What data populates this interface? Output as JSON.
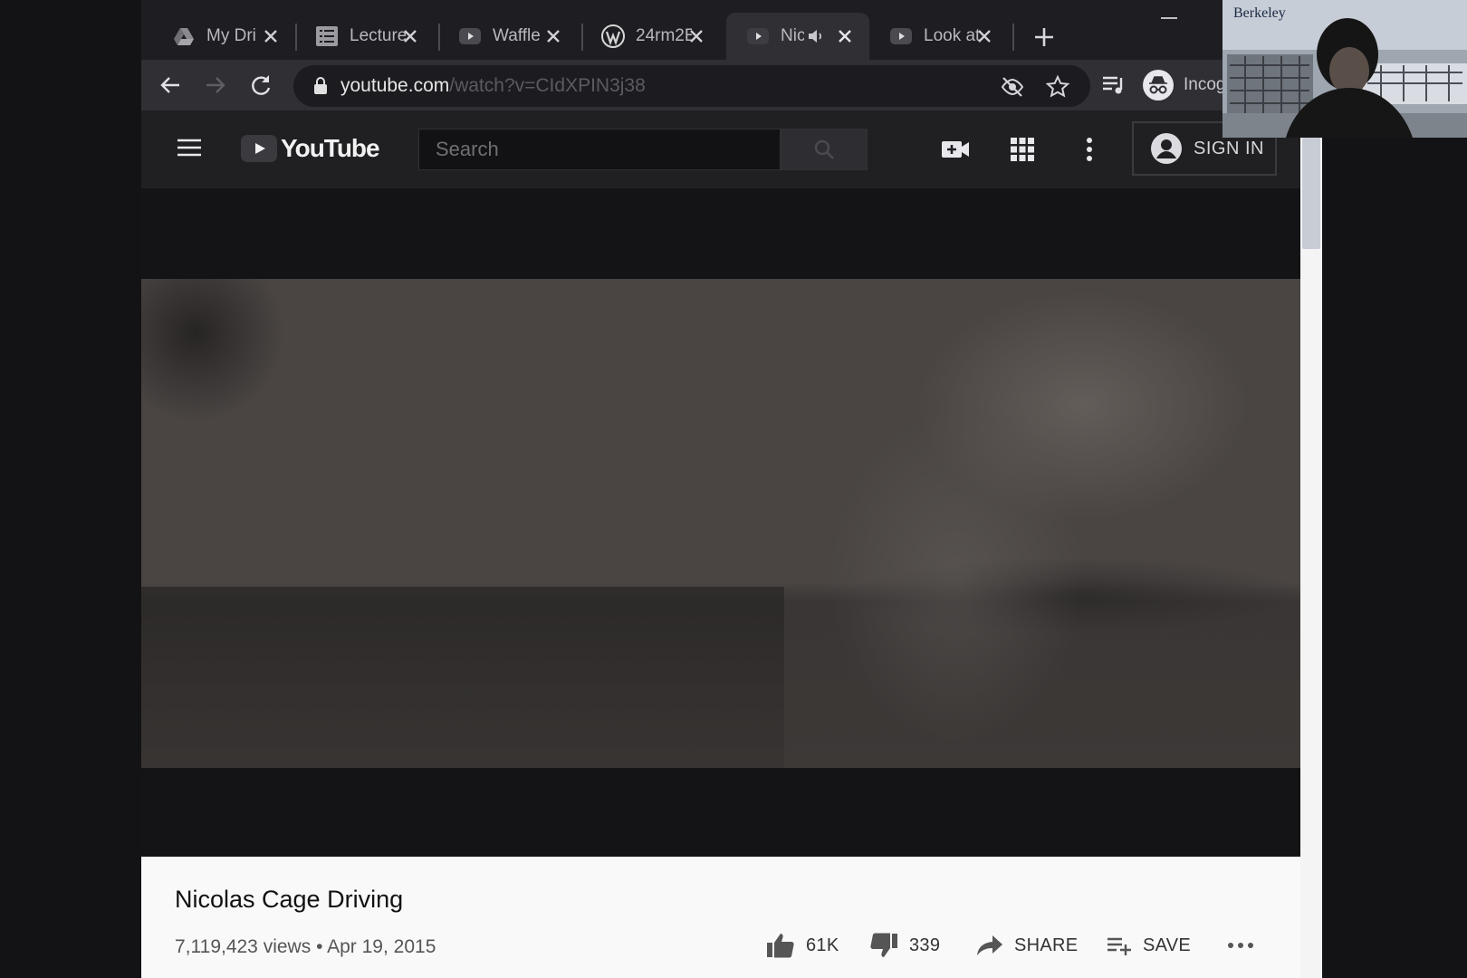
{
  "tabs": [
    {
      "label": "My Dri",
      "icon": "drive-icon"
    },
    {
      "label": "Lecture",
      "icon": "list-icon"
    },
    {
      "label": "Waffle",
      "icon": "youtube-icon"
    },
    {
      "label": "24rm2E",
      "icon": "wordpress-icon"
    },
    {
      "label": "Nic",
      "icon": "youtube-icon",
      "active": true,
      "audio": true
    },
    {
      "label": "Look at",
      "icon": "youtube-icon"
    }
  ],
  "toolbar": {
    "url_host": "youtube.com",
    "url_path": "/watch?v=CIdXPIN3j38",
    "incognito_label": "Incog"
  },
  "youtube": {
    "logo_text": "YouTube",
    "search_placeholder": "Search",
    "signin_label": "SIGN IN"
  },
  "video": {
    "title": "Nicolas Cage Driving",
    "views": "7,119,423 views",
    "separator": "•",
    "date": "Apr 19, 2015",
    "likes": "61K",
    "dislikes": "339",
    "share_label": "SHARE",
    "save_label": "SAVE"
  },
  "webcam": {
    "label": "Berkeley"
  },
  "colors": {
    "yt_header": "#202023",
    "page_bg": "#131316",
    "info_bg": "#f9f9f9"
  }
}
